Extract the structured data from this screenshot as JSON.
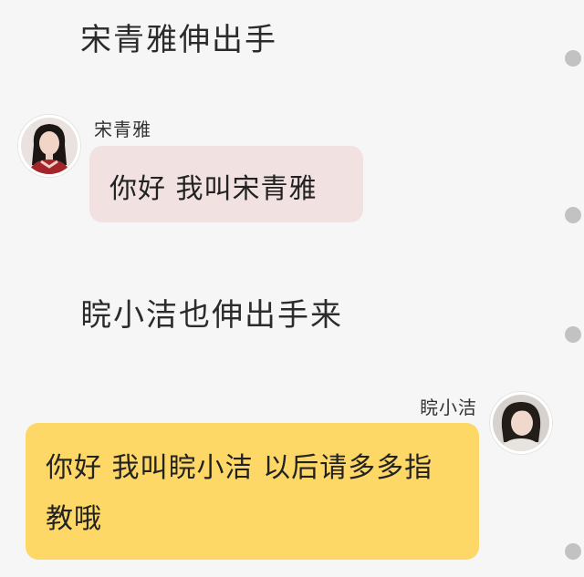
{
  "narrations": [
    "宋青雅伸出手",
    "睆小洁也伸出手来"
  ],
  "messages": [
    {
      "sender": "宋青雅",
      "side": "left",
      "text": "你好 我叫宋青雅",
      "bubble_color": "#f2e1e1"
    },
    {
      "sender": "睆小洁",
      "side": "right",
      "text": "你好 我叫睆小洁 以后请多多指教哦",
      "bubble_color": "#fdd866"
    }
  ],
  "colors": {
    "background": "#f6f6f6",
    "scroll_dot": "#c2c2c2"
  }
}
